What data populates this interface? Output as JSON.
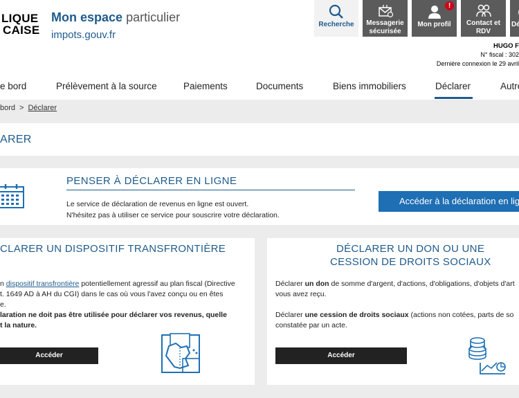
{
  "header": {
    "logo_line1": "LIQUE",
    "logo_line2": "CAISE",
    "site_title_strong": "Mon espace",
    "site_title_light": "particulier",
    "site_subtitle": "impots.gouv.fr",
    "toolbar": {
      "search_label": "Recherche",
      "messaging_label_1": "Messagerie",
      "messaging_label_2": "sécurisée",
      "profile_label": "Mon profil",
      "profile_badge": "!",
      "contact_label_1": "Contact et",
      "contact_label_2": "RDV",
      "logout_label": "Dé"
    },
    "user": {
      "name": "HUGO F",
      "fiscal_number": "N° fiscal : 302",
      "last_login": "Dernière connexion le 29 avril"
    }
  },
  "nav": {
    "items": [
      {
        "label": "e bord"
      },
      {
        "label": "Prélèvement à la source"
      },
      {
        "label": "Paiements"
      },
      {
        "label": "Documents"
      },
      {
        "label": "Biens immobiliers"
      },
      {
        "label": "Déclarer"
      },
      {
        "label": "Autre"
      }
    ],
    "active": "Déclarer"
  },
  "breadcrumb": {
    "parent": "bord",
    "separator": ">",
    "current": "Déclarer"
  },
  "page_title": "ARER",
  "promo": {
    "title": "PENSER À DÉCLARER EN LIGNE",
    "line1": "Le service de déclaration de revenus en ligne est ouvert.",
    "line2": "N'hésitez pas à utiliser ce service pour souscrire votre déclaration.",
    "button": "Accéder à la déclaration en ligne"
  },
  "card_left": {
    "title": "CLARER UN DISPOSITIF TRANSFRONTIÈRE",
    "p1_prefix": "n ",
    "p1_link": "dispositif transfrontière",
    "p1_suffix": " potentiellement agressif au plan fiscal (Directive",
    "p2": "t. 1649 AD à AH du CGI) dans le cas où vous l'avez conçu ou en êtes",
    "p3": "e.",
    "p4": "laration ne doit pas être utilisée pour déclarer vos revenus, quelle",
    "p5": "t la nature.",
    "button": "Accéder"
  },
  "card_right": {
    "title_1": "DÉCLARER UN DON OU UNE",
    "title_2": "CESSION DE DROITS SOCIAUX",
    "p1_prefix": "Déclarer ",
    "p1_bold": "un don",
    "p1_suffix": " de somme d'argent, d'actions, d'obligations, d'objets d'art",
    "p2": "vous avez reçu.",
    "p3_prefix": "Déclarer ",
    "p3_bold": "une cession de droits sociaux",
    "p3_suffix": " (actions non cotées, parts de so",
    "p4": "constatée par un acte.",
    "button": "Accéder"
  },
  "colors": {
    "brand_blue": "#1e5b8c",
    "button_blue": "#1e6fb4",
    "toolbar_dark": "#5b5b5b",
    "badge_red": "#d0021b"
  }
}
